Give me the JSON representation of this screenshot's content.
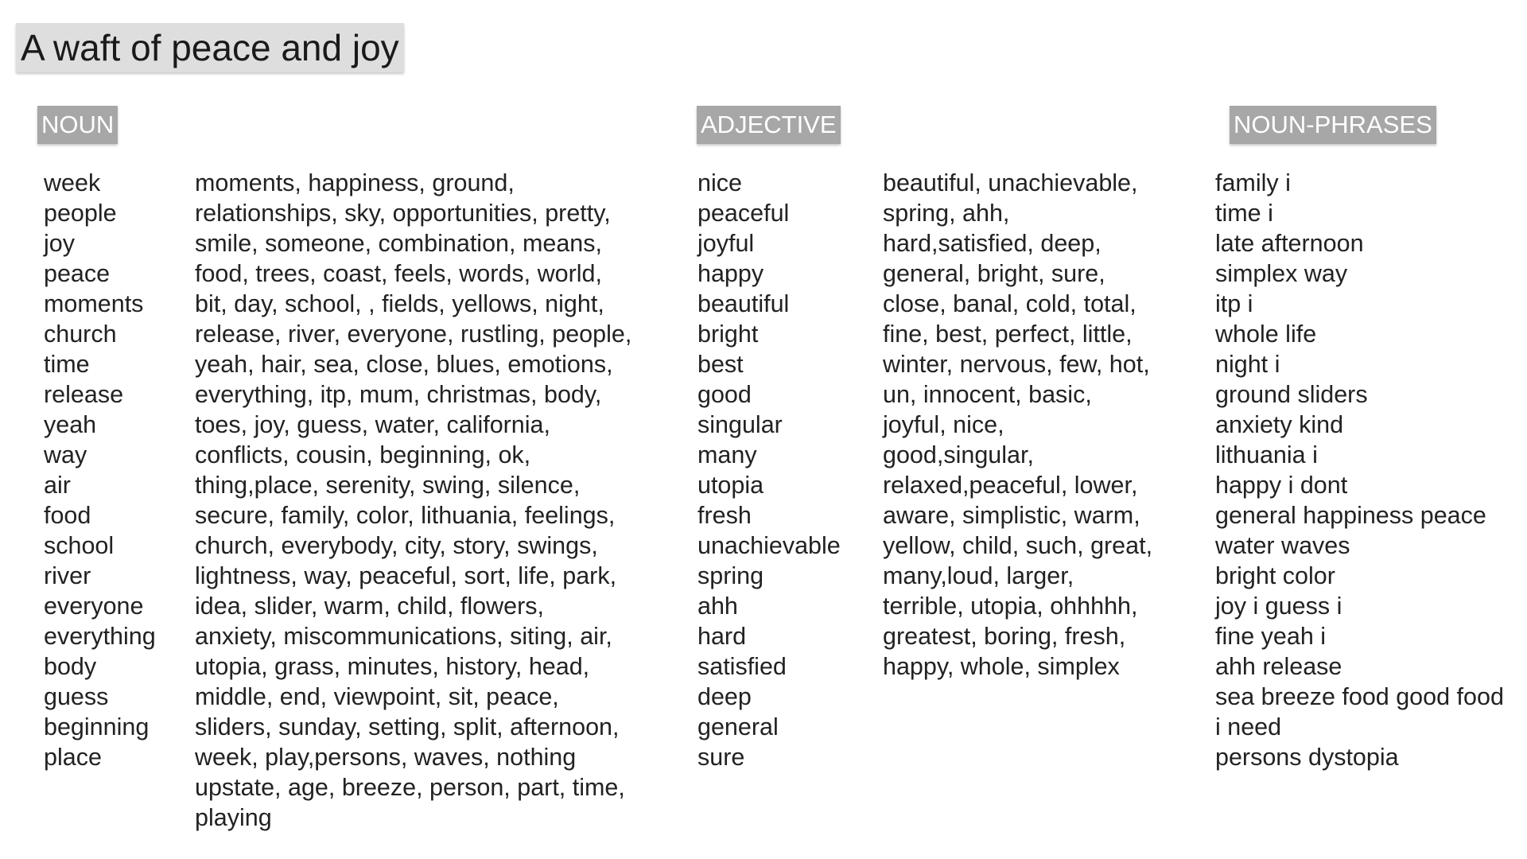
{
  "title": "A waft of peace and joy",
  "sections": {
    "noun": "NOUN",
    "adjective": "ADJECTIVE",
    "noun_phrases": "NOUN-PHRASES"
  },
  "nouns_top": [
    "week",
    "people",
    "joy",
    "peace",
    "moments",
    "church",
    "time",
    "release",
    "yeah",
    "way",
    "air",
    "food",
    "school",
    "river",
    "everyone",
    "everything",
    "body",
    "guess",
    "beginning",
    "place"
  ],
  "nouns_list": [
    "moments, happiness, ground,",
    "relationships, sky, opportunities, pretty,",
    "smile, someone, combination, means,",
    "food, trees, coast, feels, words, world,",
    "bit, day, school, , fields, yellows, night,",
    "release, river, everyone, rustling, people,",
    "yeah, hair, sea, close, blues, emotions,",
    "everything, itp, mum, christmas, body,",
    "toes, joy, guess, water, california,",
    "conflicts, cousin, beginning, ok,",
    "thing,place, serenity, swing, silence,",
    "secure, family, color, lithuania, feelings,",
    "church, everybody, city, story, swings,",
    "lightness, way, peaceful, sort, life, park,",
    "idea, slider, warm, child, flowers,",
    "anxiety, miscommunications, siting, air,",
    "utopia, grass, minutes, history, head,",
    "middle, end, viewpoint, sit, peace,",
    "sliders, sunday, setting, split, afternoon,",
    "week, play,persons, waves, nothing",
    "upstate, age, breeze, person, part, time,",
    "playing"
  ],
  "adjectives_top": [
    "nice",
    "peaceful",
    "joyful",
    "happy",
    "beautiful",
    "bright",
    "best",
    "good",
    "singular",
    "many",
    "utopia",
    "fresh",
    "unachievable",
    "spring",
    "ahh",
    "hard",
    "satisfied",
    "deep",
    "general",
    "sure"
  ],
  "adjectives_list": [
    "beautiful, unachievable,",
    "spring, ahh,",
    "hard,satisfied, deep,",
    "general, bright, sure,",
    "close, banal, cold, total,",
    "fine, best, perfect, little,",
    "winter, nervous, few, hot,",
    "un, innocent, basic,",
    "joyful, nice,",
    "good,singular,",
    "relaxed,peaceful, lower,",
    "aware, simplistic, warm,",
    "yellow, child, such, great,",
    "many,loud, larger,",
    "terrible, utopia, ohhhhh,",
    "greatest, boring, fresh,",
    "happy, whole, simplex"
  ],
  "noun_phrases": [
    "family i",
    "time i",
    "late afternoon",
    "simplex way",
    "itp i",
    "whole life",
    "night i",
    "ground sliders",
    "anxiety kind",
    "lithuania i",
    "happy i dont",
    "general happiness peace",
    "water waves",
    "bright color",
    "joy i guess i",
    "fine yeah i",
    "ahh release",
    "sea breeze food good food",
    "i need",
    "persons dystopia"
  ]
}
